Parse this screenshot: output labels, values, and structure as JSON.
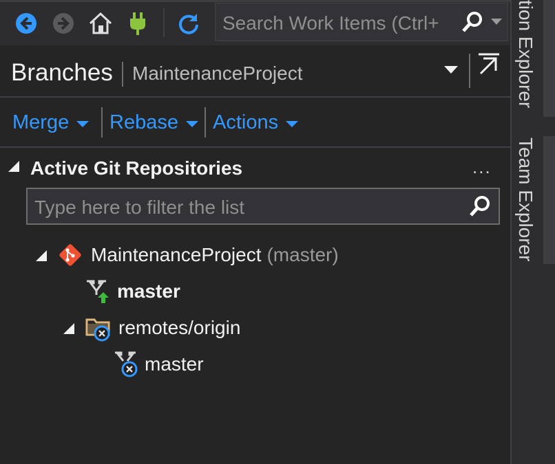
{
  "toolbar": {
    "icons": [
      "back-icon",
      "forward-icon",
      "home-icon",
      "connect-icon",
      "refresh-icon",
      "search-icon"
    ],
    "search_placeholder": "Search Work Items (Ctrl+"
  },
  "header": {
    "title": "Branches",
    "subtitle": "MaintenanceProject"
  },
  "actions": [
    {
      "label": "Merge"
    },
    {
      "label": "Rebase"
    },
    {
      "label": "Actions"
    }
  ],
  "repos": {
    "section_title": "Active Git Repositories",
    "more": "...",
    "filter_placeholder": "Type here to filter the list",
    "tree": {
      "repo_name": "MaintenanceProject",
      "repo_branch": "(master)",
      "local_branch": "master",
      "remote_folder": "remotes/origin",
      "remote_branch": "master"
    }
  },
  "right_tabs": [
    "tion Explorer",
    "Team Explorer"
  ],
  "colors": {
    "accent": "#3399ff",
    "git": "#f05133",
    "plug": "#8cc43f",
    "background": "#252526"
  }
}
